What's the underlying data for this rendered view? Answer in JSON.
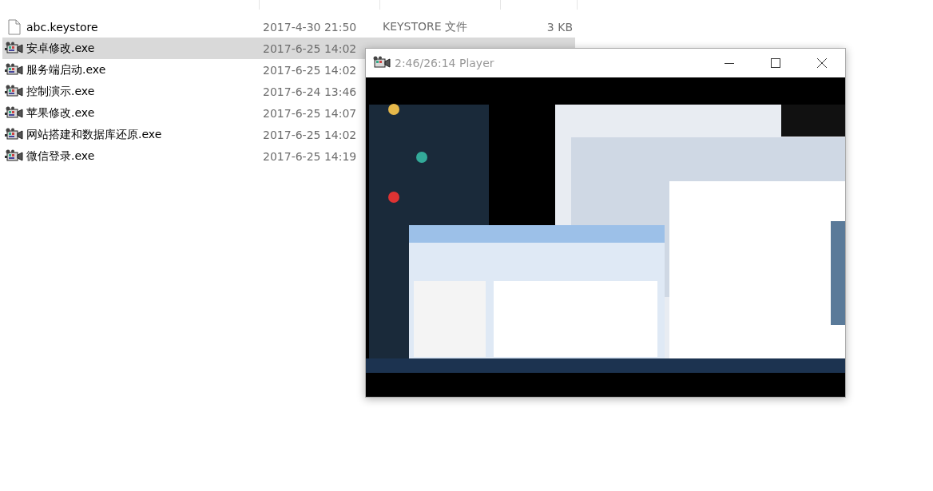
{
  "files": [
    {
      "name": "abc.keystore",
      "date": "2017-4-30 21:50",
      "type": "KEYSTORE 文件",
      "size": "3 KB",
      "kind": "document",
      "selected": false
    },
    {
      "name": "安卓修改.exe",
      "date": "2017-6-25 14:02",
      "kind": "program",
      "selected": true
    },
    {
      "name": "服务端启动.exe",
      "date": "2017-6-25 14:02",
      "kind": "program",
      "selected": false
    },
    {
      "name": "控制演示.exe",
      "date": "2017-6-24 13:46",
      "kind": "program",
      "selected": false
    },
    {
      "name": "苹果修改.exe",
      "date": "2017-6-25 14:07",
      "kind": "program",
      "selected": false
    },
    {
      "name": "网站搭建和数据库还原.exe",
      "date": "2017-6-25 14:02",
      "kind": "program",
      "selected": false
    },
    {
      "name": "微信登录.exe",
      "date": "2017-6-25 14:19",
      "kind": "program",
      "selected": false
    }
  ],
  "player": {
    "title": "2:46/26:14 Player"
  }
}
